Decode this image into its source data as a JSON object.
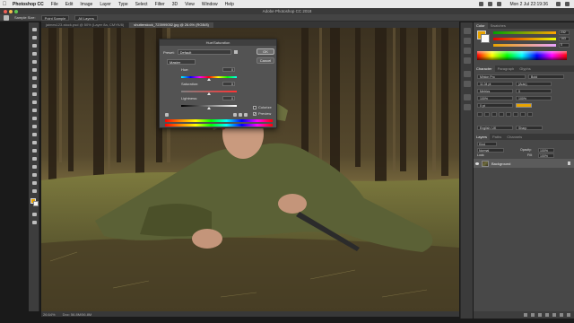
{
  "menubar": {
    "items": [
      "Photoshop CC",
      "File",
      "Edit",
      "Image",
      "Layer",
      "Type",
      "Select",
      "Filter",
      "3D",
      "View",
      "Window",
      "Help"
    ],
    "clock": "Mon 2 Jul  22:19:36"
  },
  "app": {
    "title": "Adobe Photoshop CC 2018"
  },
  "options_bar": {
    "sample_size_label": "Sample Size:",
    "sample_size": "Point Sample",
    "all_layers": "All Layers"
  },
  "tabs": [
    {
      "label": "jaimes123-stock.psd @ 50% (Layer 8a, CMYK/8)"
    },
    {
      "label": "shutterstock_723999052.jpg @ 26.6% (RGB/8)"
    }
  ],
  "status": {
    "zoom": "26.64%",
    "doc": "Doc: 56.8M/56.8M"
  },
  "dialog": {
    "title": "Hue/Saturation",
    "preset_label": "Preset:",
    "preset_value": "Default",
    "channel_value": "Master",
    "ok_label": "OK",
    "cancel_label": "Cancel",
    "hue_label": "Hue:",
    "hue_value": "0",
    "saturation_label": "Saturation:",
    "saturation_value": "0",
    "lightness_label": "Lightness:",
    "lightness_value": "0",
    "colorize_label": "Colorize",
    "preview_label": "Preview",
    "preview_checked": true,
    "colorize_checked": false
  },
  "color_panel": {
    "tabs": [
      "Color",
      "Swatches"
    ],
    "fg_color": "#e8a300",
    "bg_color": "#fafafa",
    "r": "232",
    "g": "163",
    "b": "0"
  },
  "character_panel": {
    "tabs": [
      "Character",
      "Paragraph",
      "Glyphs"
    ],
    "font": "Minion Pro",
    "style": "Bold",
    "size": "11.04 pt",
    "leading": "(Auto)",
    "tracking": "0",
    "kerning": "Metrics",
    "scale_v": "100%",
    "scale_h": "100%",
    "baseline": "0 pt",
    "language": "English: UK",
    "aa": "Sharp"
  },
  "layers_panel": {
    "tabs": [
      "Layers",
      "Paths",
      "Channels"
    ],
    "kind_label": "Kind",
    "blend": "Normal",
    "opacity_label": "Opacity:",
    "opacity": "100%",
    "lock_label": "Lock:",
    "fill_label": "Fill:",
    "fill": "100%",
    "layer_name": "Background"
  }
}
